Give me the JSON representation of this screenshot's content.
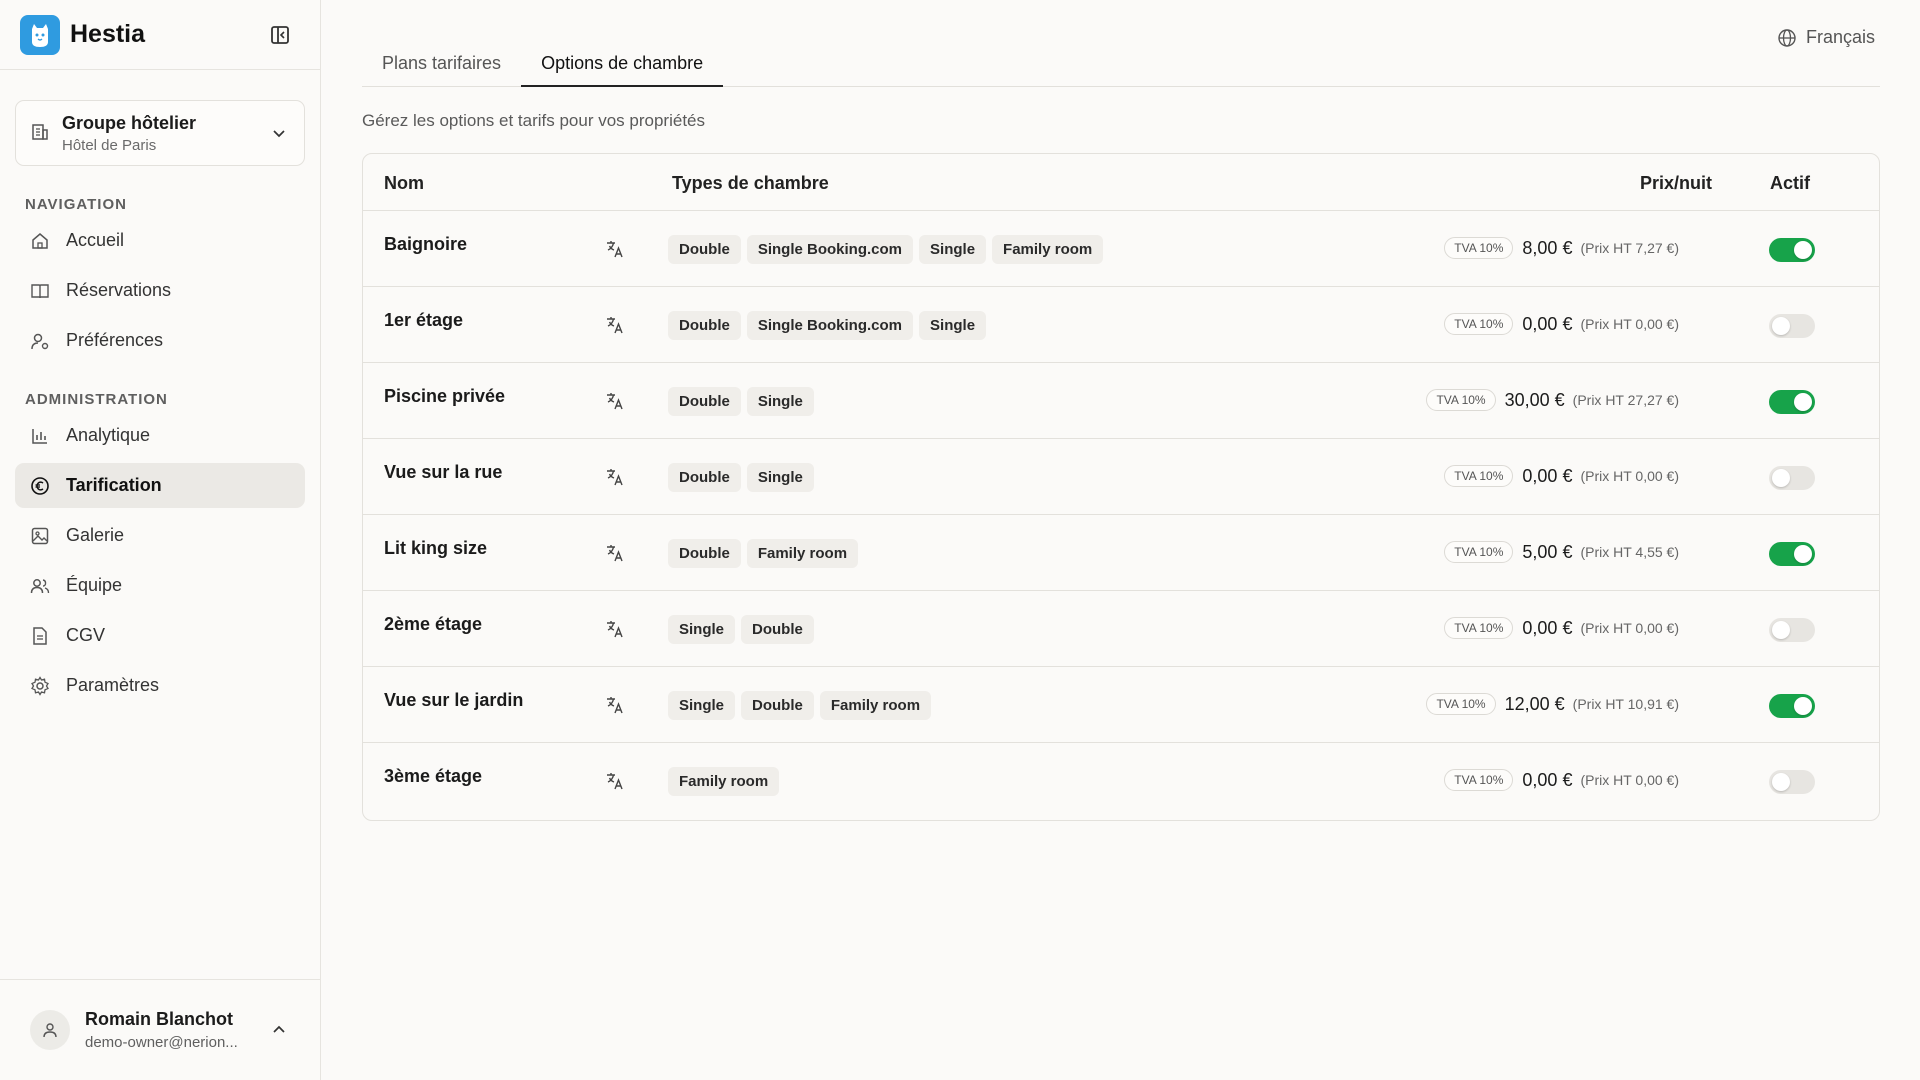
{
  "app": {
    "name": "Hestia"
  },
  "org": {
    "title": "Groupe hôtelier",
    "subtitle": "Hôtel de Paris"
  },
  "nav": {
    "section_navigation": "NAVIGATION",
    "section_admin": "ADMINISTRATION",
    "items": [
      {
        "label": "Accueil",
        "icon": "home-icon"
      },
      {
        "label": "Réservations",
        "icon": "book-icon"
      },
      {
        "label": "Préférences",
        "icon": "user-settings-icon"
      },
      {
        "label": "Analytique",
        "icon": "chart-icon"
      },
      {
        "label": "Tarification",
        "icon": "euro-icon"
      },
      {
        "label": "Galerie",
        "icon": "image-icon"
      },
      {
        "label": "Équipe",
        "icon": "team-icon"
      },
      {
        "label": "CGV",
        "icon": "document-icon"
      },
      {
        "label": "Paramètres",
        "icon": "gear-icon"
      }
    ],
    "active": "Tarification"
  },
  "user": {
    "name": "Romain Blanchot",
    "email": "demo-owner@nerion..."
  },
  "language": "Français",
  "tabs": [
    "Plans tarifaires",
    "Options de chambre"
  ],
  "active_tab": "Options de chambre",
  "subtitle": "Gérez les options et tarifs pour vos propriétés",
  "table": {
    "headers": {
      "name": "Nom",
      "types": "Types de chambre",
      "price": "Prix/nuit",
      "active": "Actif"
    },
    "rows": [
      {
        "name": "Baignoire",
        "types": [
          "Double",
          "Single Booking.com",
          "Single",
          "Family room"
        ],
        "tva": "TVA 10%",
        "price": "8,00 €",
        "ht": "(Prix HT 7,27 €)",
        "active": true
      },
      {
        "name": "1er étage",
        "types": [
          "Double",
          "Single Booking.com",
          "Single"
        ],
        "tva": "TVA 10%",
        "price": "0,00 €",
        "ht": "(Prix HT 0,00 €)",
        "active": false
      },
      {
        "name": "Piscine privée",
        "types": [
          "Double",
          "Single"
        ],
        "tva": "TVA 10%",
        "price": "30,00 €",
        "ht": "(Prix HT 27,27 €)",
        "active": true
      },
      {
        "name": "Vue sur la rue",
        "types": [
          "Double",
          "Single"
        ],
        "tva": "TVA 10%",
        "price": "0,00 €",
        "ht": "(Prix HT 0,00 €)",
        "active": false
      },
      {
        "name": "Lit king size",
        "types": [
          "Double",
          "Family room"
        ],
        "tva": "TVA 10%",
        "price": "5,00 €",
        "ht": "(Prix HT 4,55 €)",
        "active": true
      },
      {
        "name": "2ème étage",
        "types": [
          "Single",
          "Double"
        ],
        "tva": "TVA 10%",
        "price": "0,00 €",
        "ht": "(Prix HT 0,00 €)",
        "active": false
      },
      {
        "name": "Vue sur le jardin",
        "types": [
          "Single",
          "Double",
          "Family room"
        ],
        "tva": "TVA 10%",
        "price": "12,00 €",
        "ht": "(Prix HT 10,91 €)",
        "active": true
      },
      {
        "name": "3ème étage",
        "types": [
          "Family room"
        ],
        "tva": "TVA 10%",
        "price": "0,00 €",
        "ht": "(Prix HT 0,00 €)",
        "active": false
      }
    ]
  },
  "colors": {
    "accent_green": "#17a34a",
    "logo_blue": "#2f9be0"
  }
}
